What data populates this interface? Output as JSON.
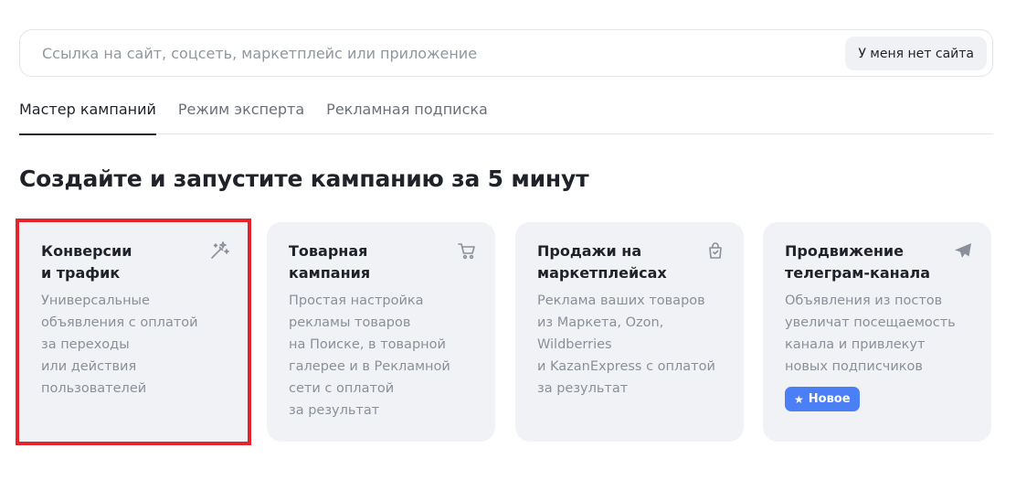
{
  "search": {
    "placeholder": "Ссылка на сайт, соцсеть, маркетплейс или приложение",
    "value": "",
    "no_site_label": "У меня нет сайта"
  },
  "tabs": [
    {
      "label": "Мастер кампаний",
      "active": true
    },
    {
      "label": "Режим эксперта",
      "active": false
    },
    {
      "label": "Рекламная подписка",
      "active": false
    }
  ],
  "page_title": "Создайте и запустите кампанию за 5 минут",
  "cards": [
    {
      "title": "Конверсии\nи трафик",
      "description": "Универсальные\nобъявления с оплатой\nза переходы\nили действия\nпользователей",
      "icon": "magic-wand-icon"
    },
    {
      "title": "Товарная\nкампания",
      "description": "Простая настройка\nрекламы товаров\nна Поиске, в товарной\nгалерее и в Рекламной\nсети с оплатой\nза результат",
      "icon": "cart-icon"
    },
    {
      "title": "Продажи на\nмаркетплейсах",
      "description": "Реклама ваших товаров\nиз Маркета, Ozon,\nWildberries\nи KazanExpress с оплатой\nза результат",
      "icon": "shopping-bag-icon"
    },
    {
      "title": "Продвижение\nтелеграм-канала",
      "description": "Объявления из постов\nувеличат посещаемость\nканала и привлекут\nновых подписчиков",
      "icon": "paper-plane-icon",
      "badge": "Новое"
    }
  ],
  "colors": {
    "card_bg": "#f0f2f6",
    "highlight": "#e3242b",
    "badge_bg": "#4b7ff5",
    "icon": "#8a909a"
  }
}
